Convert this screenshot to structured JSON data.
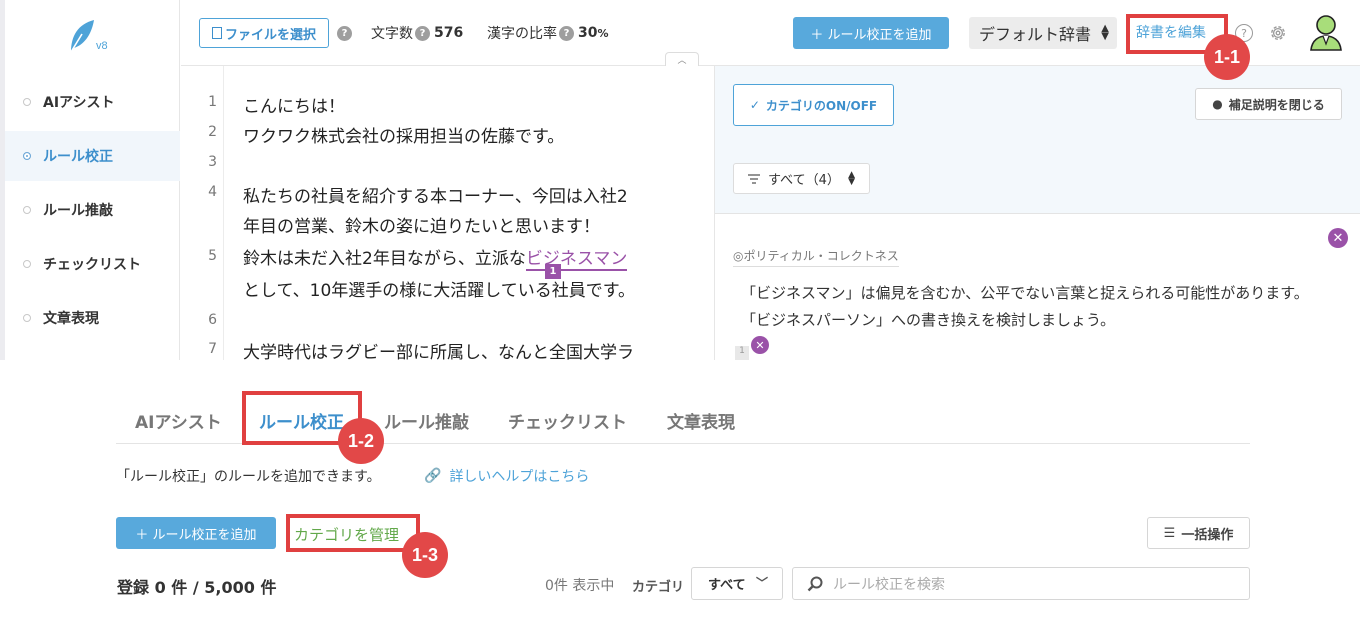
{
  "app": {
    "logo": {
      "version": "v8"
    },
    "sidebar": {
      "items": [
        {
          "label": "AIアシスト"
        },
        {
          "label": "ルール校正"
        },
        {
          "label": "ルール推敲"
        },
        {
          "label": "チェックリスト"
        },
        {
          "label": "文章表現"
        }
      ]
    },
    "topbar": {
      "file_button": "ファイルを選択",
      "char_count_label": "文字数",
      "char_count_value": "576",
      "kanji_ratio_label": "漢字の比率",
      "kanji_ratio_value": "30",
      "kanji_ratio_unit": "%",
      "add_rule_button": "＋ ルール校正を追加",
      "dictionary_select": "デフォルト辞書",
      "edit_dictionary_link": "辞書を編集",
      "help_icon_glyph": "?"
    },
    "editor": {
      "line_numbers": [
        "1",
        "2",
        "3",
        "4",
        "",
        "5",
        "",
        "6",
        "7"
      ],
      "lines": [
        "こんにちは！",
        "ワクワク株式会社の採用担当の佐藤です。",
        "",
        "私たちの社員を紹介する本コーナー、今回は入社2",
        "年目の営業、鈴木の姿に迫りたいと思います！",
        {
          "before": "鈴木は未だ入社2年目ながら、立派な",
          "highlight": "ビジネスマン"
        },
        "として、10年選手の様に大活躍している社員です。",
        "",
        "大学時代はラグビー部に所属し、なんと全国大学ラ"
      ],
      "mark_badge": "1"
    },
    "panel": {
      "category_toggle": "カテゴリのON/OFF",
      "close_supplement": "補足説明を閉じる",
      "filter": "すべて（4）",
      "card": {
        "category": "ポリティカル・コレクトネス",
        "message_1": "「ビジネスマン」は偏見を含むか、公平でない言葉と捉えられる可能性があります。",
        "message_2": "「ビジネスパーソン」への書き換えを検討しましょう。",
        "badge": "1"
      }
    }
  },
  "rule_panel": {
    "tabs": [
      {
        "label": "AIアシスト"
      },
      {
        "label": "ルール校正"
      },
      {
        "label": "ルール推敲"
      },
      {
        "label": "チェックリスト"
      },
      {
        "label": "文章表現"
      }
    ],
    "description": "「ルール校正」のルールを追加できます。",
    "help_link": "詳しいヘルプはこちら",
    "add_button": "＋ ルール校正を追加",
    "category_manage": "カテゴリを管理",
    "bulk_button": "一括操作",
    "count_text": "登録 0 件 / 5,000 件",
    "showing_text": "0件 表示中",
    "category_label": "カテゴリ",
    "category_select": "すべて",
    "search_placeholder": "ルール校正を検索"
  },
  "annotations": {
    "callout_1": "1-1",
    "callout_2": "1-2",
    "callout_3": "1-3"
  },
  "colors": {
    "accent": "#3d8fcc",
    "highlight_purple": "#9a52a8",
    "annotation_red": "#e24848",
    "category_green": "#62a84a"
  }
}
